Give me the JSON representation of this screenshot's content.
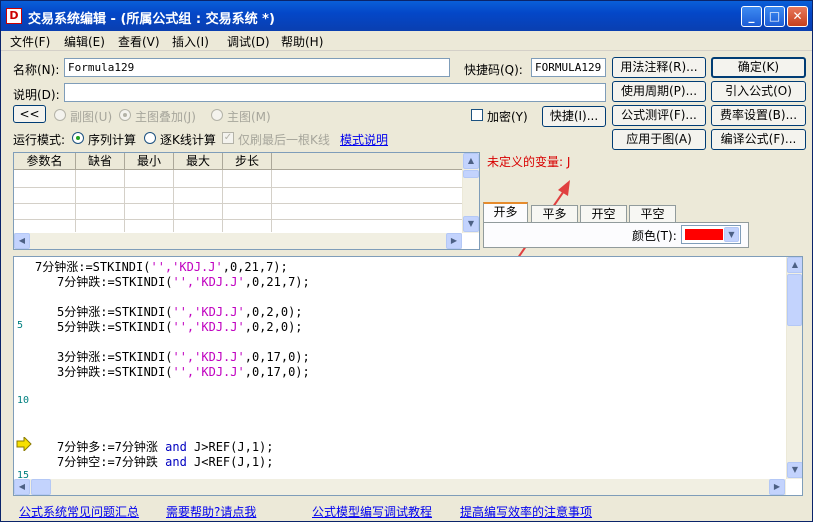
{
  "window": {
    "icon_letter": "D",
    "title": "交易系统编辑 - (所属公式组 : 交易系统 *)",
    "min_glyph": "_",
    "max_glyph": "□",
    "close_glyph": "✕"
  },
  "menu": [
    "文件(F)",
    "编辑(E)",
    "查看(V)",
    "插入(I)",
    "调试(D)",
    "帮助(H)"
  ],
  "form": {
    "name_label": "名称(N):",
    "name_value": "Formula129",
    "shortcut_label": "快捷码(Q):",
    "shortcut_value": "FORMULA129",
    "desc_label": "说明(D):",
    "desc_value": "",
    "collapse_label": "<<",
    "radio_subchart": "副图(U)",
    "radio_overlay": "主图叠加(J)",
    "radio_mainchart": "主图(M)",
    "encrypt_label": "加密(Y)",
    "quick_button": "快捷(I)...",
    "run_mode_label": "运行模式:",
    "radio_sequential": "序列计算",
    "radio_perbar": "逐K线计算",
    "check_lastbar": "仅刷最后一根K线",
    "mode_help_link": "模式说明"
  },
  "buttons": {
    "usage_notes": "用法注释(R)...",
    "ok": "确定(K)",
    "use_period": "使用周期(P)...",
    "import_formula": "引入公式(O)",
    "formula_test": "公式测评(F)...",
    "fee_settings": "费率设置(B)...",
    "apply_to_chart": "应用于图(A)",
    "compile_formula": "编译公式(F)..."
  },
  "param_table": {
    "columns": [
      "参数名",
      "缺省",
      "最小",
      "最大",
      "步长"
    ]
  },
  "error": {
    "text": "未定义的变量: J"
  },
  "signal_tabs": [
    "开多",
    "平多",
    "开空",
    "平空"
  ],
  "color": {
    "label": "颜色(T):",
    "value": "#ff0000"
  },
  "editor": {
    "line_numbers": [
      "5",
      "10",
      "15"
    ],
    "lines": {
      "l1a": "7分钟涨:=STKINDI(",
      "l1b": "'','KDJ.J'",
      "l1c": ",0,21,7);",
      "l2a": "7分钟跌:=STKINDI(",
      "l2b": "'','KDJ.J'",
      "l2c": ",0,21,7);",
      "l3a": "5分钟涨:=STKINDI(",
      "l3b": "'','KDJ.J'",
      "l3c": ",0,2,0);",
      "l4a": "5分钟跌:=STKINDI(",
      "l4b": "'','KDJ.J'",
      "l4c": ",0,2,0);",
      "l5a": "3分钟涨:=STKINDI(",
      "l5b": "'','KDJ.J'",
      "l5c": ",0,17,0);",
      "l6a": "3分钟跌:=STKINDI(",
      "l6b": "'','KDJ.J'",
      "l6c": ",0,17,0);",
      "l7a": "7分钟多:=7分钟涨 ",
      "l7b": "and",
      "l7c": " J>REF(J,1);",
      "l8a": "7分钟空:=7分钟跌 ",
      "l8b": "and",
      "l8c": " J<REF(J,1);"
    }
  },
  "footer": [
    "公式系统常见问题汇总",
    "需要帮助?请点我",
    "公式模型编写调试教程",
    "提高编写效率的注意事项"
  ]
}
